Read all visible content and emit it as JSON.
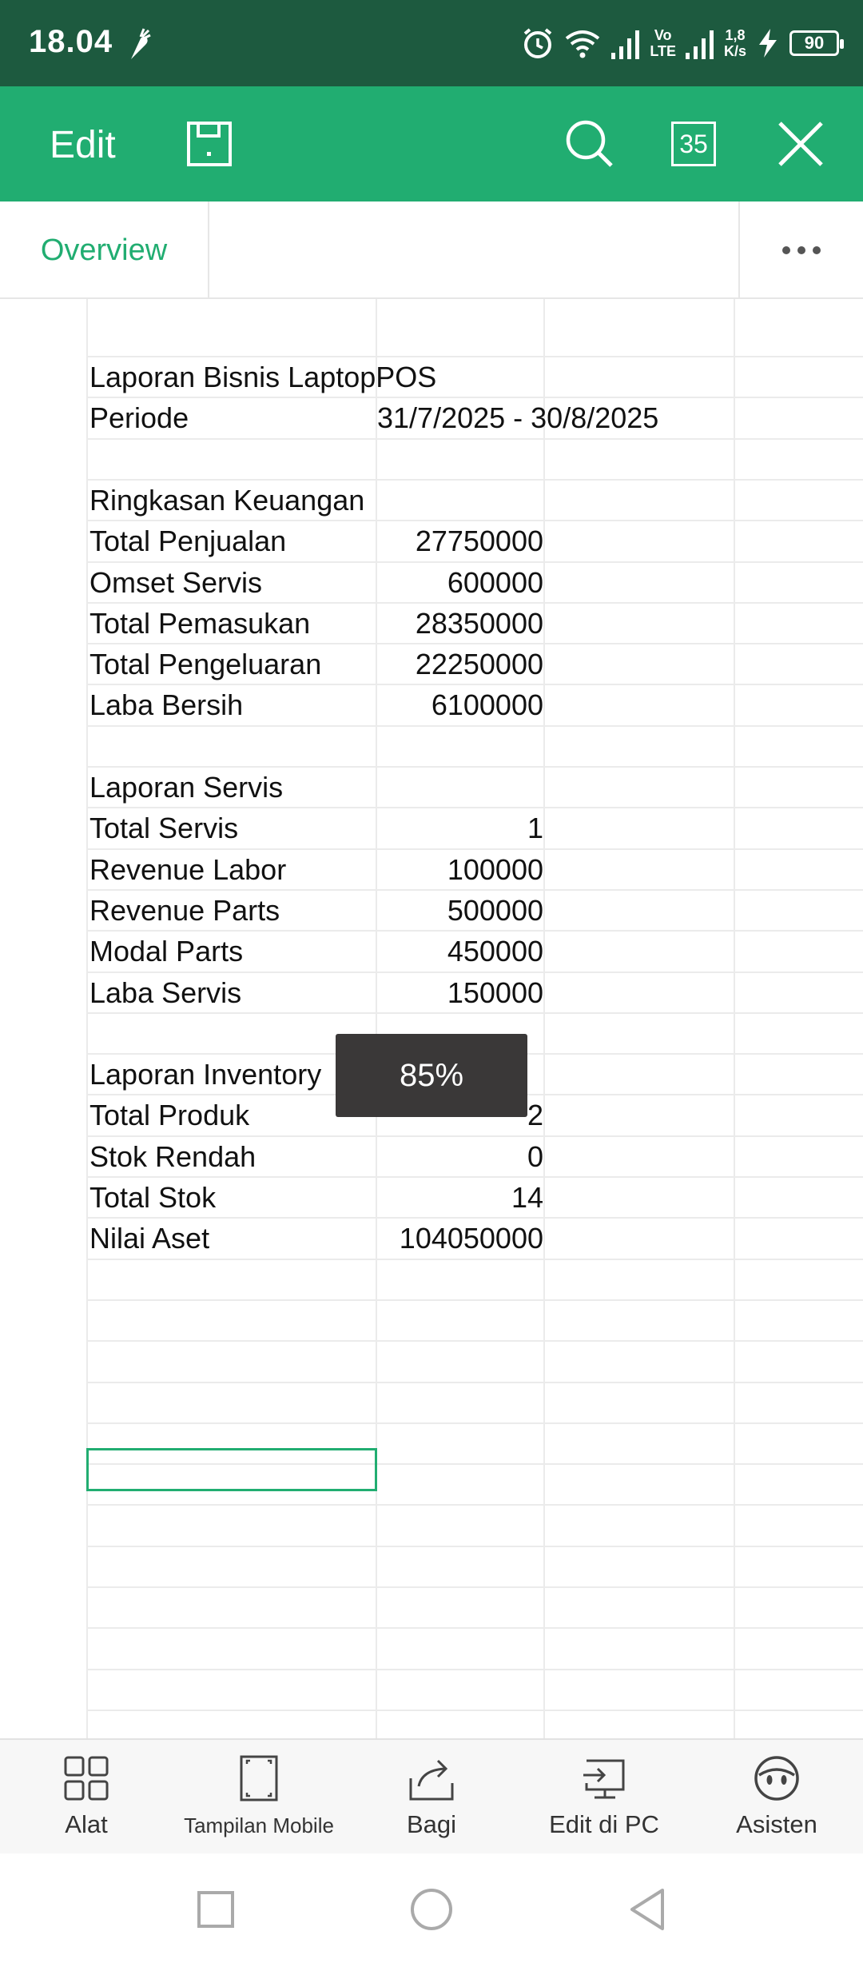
{
  "status_bar": {
    "time": "18.04",
    "network_speed_top": "1,8",
    "network_speed_bottom": "K/s",
    "volte_top": "Vo",
    "volte_bottom": "LTE",
    "battery": "90"
  },
  "toolbar": {
    "edit_label": "Edit",
    "page_count": "35"
  },
  "tabs": {
    "active_tab": "Overview"
  },
  "sheet": {
    "rows": [
      {
        "a": "Laporan Bisnis LaptopPOS",
        "b": ""
      },
      {
        "a": "Periode",
        "b": "31/7/2025 - 30/8/2025"
      },
      {
        "a": "",
        "b": ""
      },
      {
        "a": "Ringkasan Keuangan",
        "b": ""
      },
      {
        "a": "Total Penjualan",
        "b": "27750000"
      },
      {
        "a": "Omset Servis",
        "b": "600000"
      },
      {
        "a": "Total Pemasukan",
        "b": "28350000"
      },
      {
        "a": "Total Pengeluaran",
        "b": "22250000"
      },
      {
        "a": "Laba Bersih",
        "b": "6100000"
      },
      {
        "a": "",
        "b": ""
      },
      {
        "a": "Laporan Servis",
        "b": ""
      },
      {
        "a": "Total Servis",
        "b": "1"
      },
      {
        "a": "Revenue Labor",
        "b": "100000"
      },
      {
        "a": "Revenue Parts",
        "b": "500000"
      },
      {
        "a": "Modal Parts",
        "b": "450000"
      },
      {
        "a": "Laba Servis",
        "b": "150000"
      },
      {
        "a": "",
        "b": ""
      },
      {
        "a": "Laporan Inventory",
        "b": ""
      },
      {
        "a": "Total Produk",
        "b": "2"
      },
      {
        "a": "Stok Rendah",
        "b": "0"
      },
      {
        "a": "Total Stok",
        "b": "14"
      },
      {
        "a": "Nilai Aset",
        "b": "104050000"
      }
    ],
    "zoom_toast": "85%"
  },
  "bottom_bar": {
    "items": [
      {
        "label": "Alat"
      },
      {
        "label": "Tampilan Mobile"
      },
      {
        "label": "Bagi"
      },
      {
        "label": "Edit di PC"
      },
      {
        "label": "Asisten"
      }
    ]
  },
  "colors": {
    "status_bar": "#1d5a3f",
    "toolbar": "#21ad71",
    "accent": "#21ad71",
    "toast": "#3a3838"
  }
}
